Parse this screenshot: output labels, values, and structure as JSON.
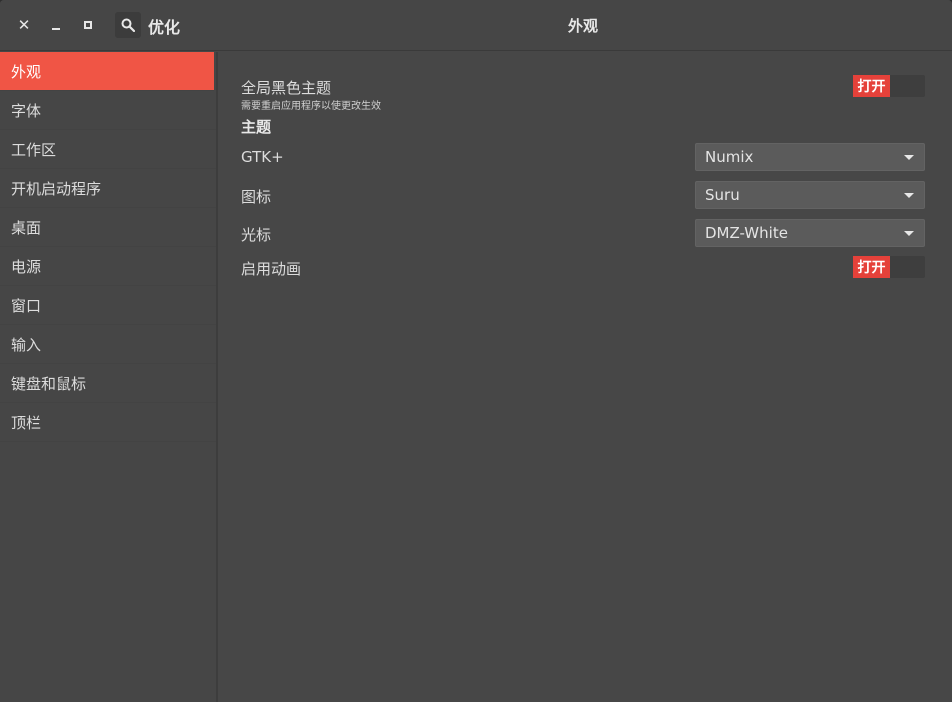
{
  "window": {
    "app_title": "优化",
    "page_heading": "外观"
  },
  "titlebar_icons": {
    "close": "close-icon",
    "minimize": "minimize-icon",
    "maximize": "maximize-icon",
    "search": "search-icon"
  },
  "sidebar": {
    "items": [
      {
        "label": "外观",
        "active": true
      },
      {
        "label": "字体"
      },
      {
        "label": "工作区"
      },
      {
        "label": "开机启动程序"
      },
      {
        "label": "桌面"
      },
      {
        "label": "电源"
      },
      {
        "label": "窗口"
      },
      {
        "label": "输入"
      },
      {
        "label": "键盘和鼠标"
      },
      {
        "label": "顶栏"
      }
    ]
  },
  "appearance": {
    "dark_theme": {
      "label": "全局黑色主题",
      "hint": "需要重启应用程序以使更改生效",
      "switch_label": "打开"
    },
    "theme_section": "主题",
    "gtk": {
      "label": "GTK+",
      "value": "Numix"
    },
    "icons": {
      "label": "图标",
      "value": "Suru"
    },
    "cursor": {
      "label": "光标",
      "value": "DMZ-White"
    },
    "animations": {
      "label": "启用动画",
      "switch_label": "打开"
    }
  },
  "colors": {
    "accent": "#f05545",
    "switch_on": "#e5413a",
    "window_bg": "#474747",
    "dropdown_bg": "#5b5b5b"
  }
}
